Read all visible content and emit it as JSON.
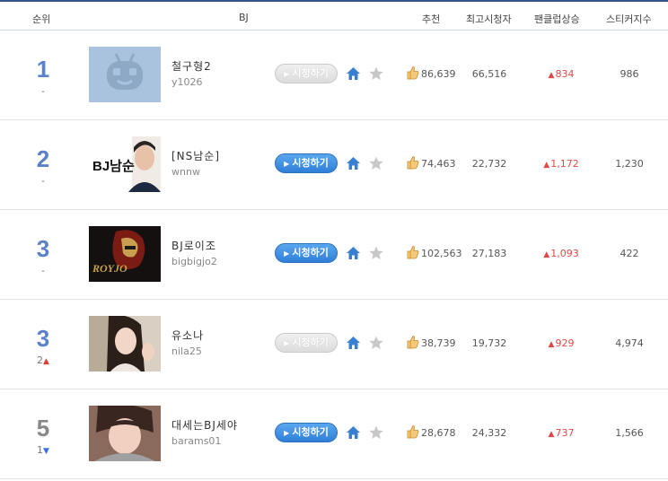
{
  "header": {
    "rank": "순위",
    "bj": "BJ",
    "recommend": "추천",
    "max_viewers": "최고시청자",
    "fanclub_up": "팬클럽상승",
    "sticker_count": "스티커지수"
  },
  "watch_label": "시청하기",
  "colors": {
    "accent": "#35548b",
    "rank_blue": "#5b82c9",
    "up_red": "#e03a3a",
    "down_blue": "#3a6fe0",
    "button_blue": "#2f7fd8"
  },
  "rows": [
    {
      "rank": "1",
      "change": "-",
      "name": "철구형2",
      "id": "y1026",
      "watch_active": false,
      "recommend": "86,639",
      "max_viewers": "66,516",
      "fan_up": "834",
      "stickers": "986",
      "thumb": "default-avatar"
    },
    {
      "rank": "2",
      "change": "-",
      "name": "[NS남순]",
      "id": "wnnw",
      "thumb_text": "BJ남순",
      "watch_active": true,
      "recommend": "74,463",
      "max_viewers": "22,732",
      "fan_up": "1,172",
      "stickers": "1,230",
      "thumb": "photo"
    },
    {
      "rank": "3",
      "change": "-",
      "name": "BJ로이조",
      "id": "bigbigjo2",
      "thumb_text": "ROYJO",
      "watch_active": true,
      "recommend": "102,563",
      "max_viewers": "27,183",
      "fan_up": "1,093",
      "stickers": "422",
      "thumb": "photo"
    },
    {
      "rank": "3",
      "change": "2",
      "change_dir": "up",
      "name": "유소나",
      "id": "nila25",
      "watch_active": false,
      "recommend": "38,739",
      "max_viewers": "19,732",
      "fan_up": "929",
      "stickers": "4,974",
      "thumb": "photo"
    },
    {
      "rank": "5",
      "change": "1",
      "change_dir": "down",
      "name": "대세는BJ세야",
      "id": "barams01",
      "watch_active": true,
      "recommend": "28,678",
      "max_viewers": "24,332",
      "fan_up": "737",
      "stickers": "1,566",
      "thumb": "photo"
    }
  ]
}
